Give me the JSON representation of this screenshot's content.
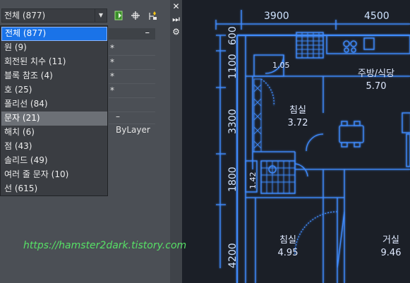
{
  "selector": {
    "value": "전체 (877)"
  },
  "dropdown": {
    "items": [
      {
        "label": "전체 (877)"
      },
      {
        "label": "원 (9)"
      },
      {
        "label": "회전된 치수 (11)"
      },
      {
        "label": "블록 참조 (4)"
      },
      {
        "label": "호 (25)"
      },
      {
        "label": "폴리선 (84)"
      },
      {
        "label": "문자 (21)"
      },
      {
        "label": "해치 (6)"
      },
      {
        "label": "점 (43)"
      },
      {
        "label": "솔리드 (49)"
      },
      {
        "label": "여러 줄 문자 (10)"
      },
      {
        "label": "선 (615)"
      }
    ]
  },
  "grid": {
    "collapse": "–",
    "rows": [
      {
        "value": "*"
      },
      {
        "value": "*"
      },
      {
        "value": "*"
      },
      {
        "value": "*"
      },
      {
        "value": ""
      },
      {
        "value": "– ByLayer"
      }
    ]
  },
  "canvas": {
    "dims_top": [
      "3900",
      "4500"
    ],
    "dims_left": [
      "600",
      "1100",
      "3300",
      "1800",
      "4200"
    ],
    "rooms": [
      {
        "name": "주방/식당",
        "area": "5.70"
      },
      {
        "name": "침실",
        "area": "3.72"
      },
      {
        "name": "침실",
        "area": "4.95"
      },
      {
        "name": "거실",
        "area": "9.46"
      }
    ],
    "labels": [
      "1.05",
      "1.42"
    ]
  },
  "watermark": "https://hamster2dark.tistory.com",
  "colors": {
    "accent": "#1a73e8",
    "cad_line": "#3f8cff",
    "watermark": "#57e066"
  }
}
